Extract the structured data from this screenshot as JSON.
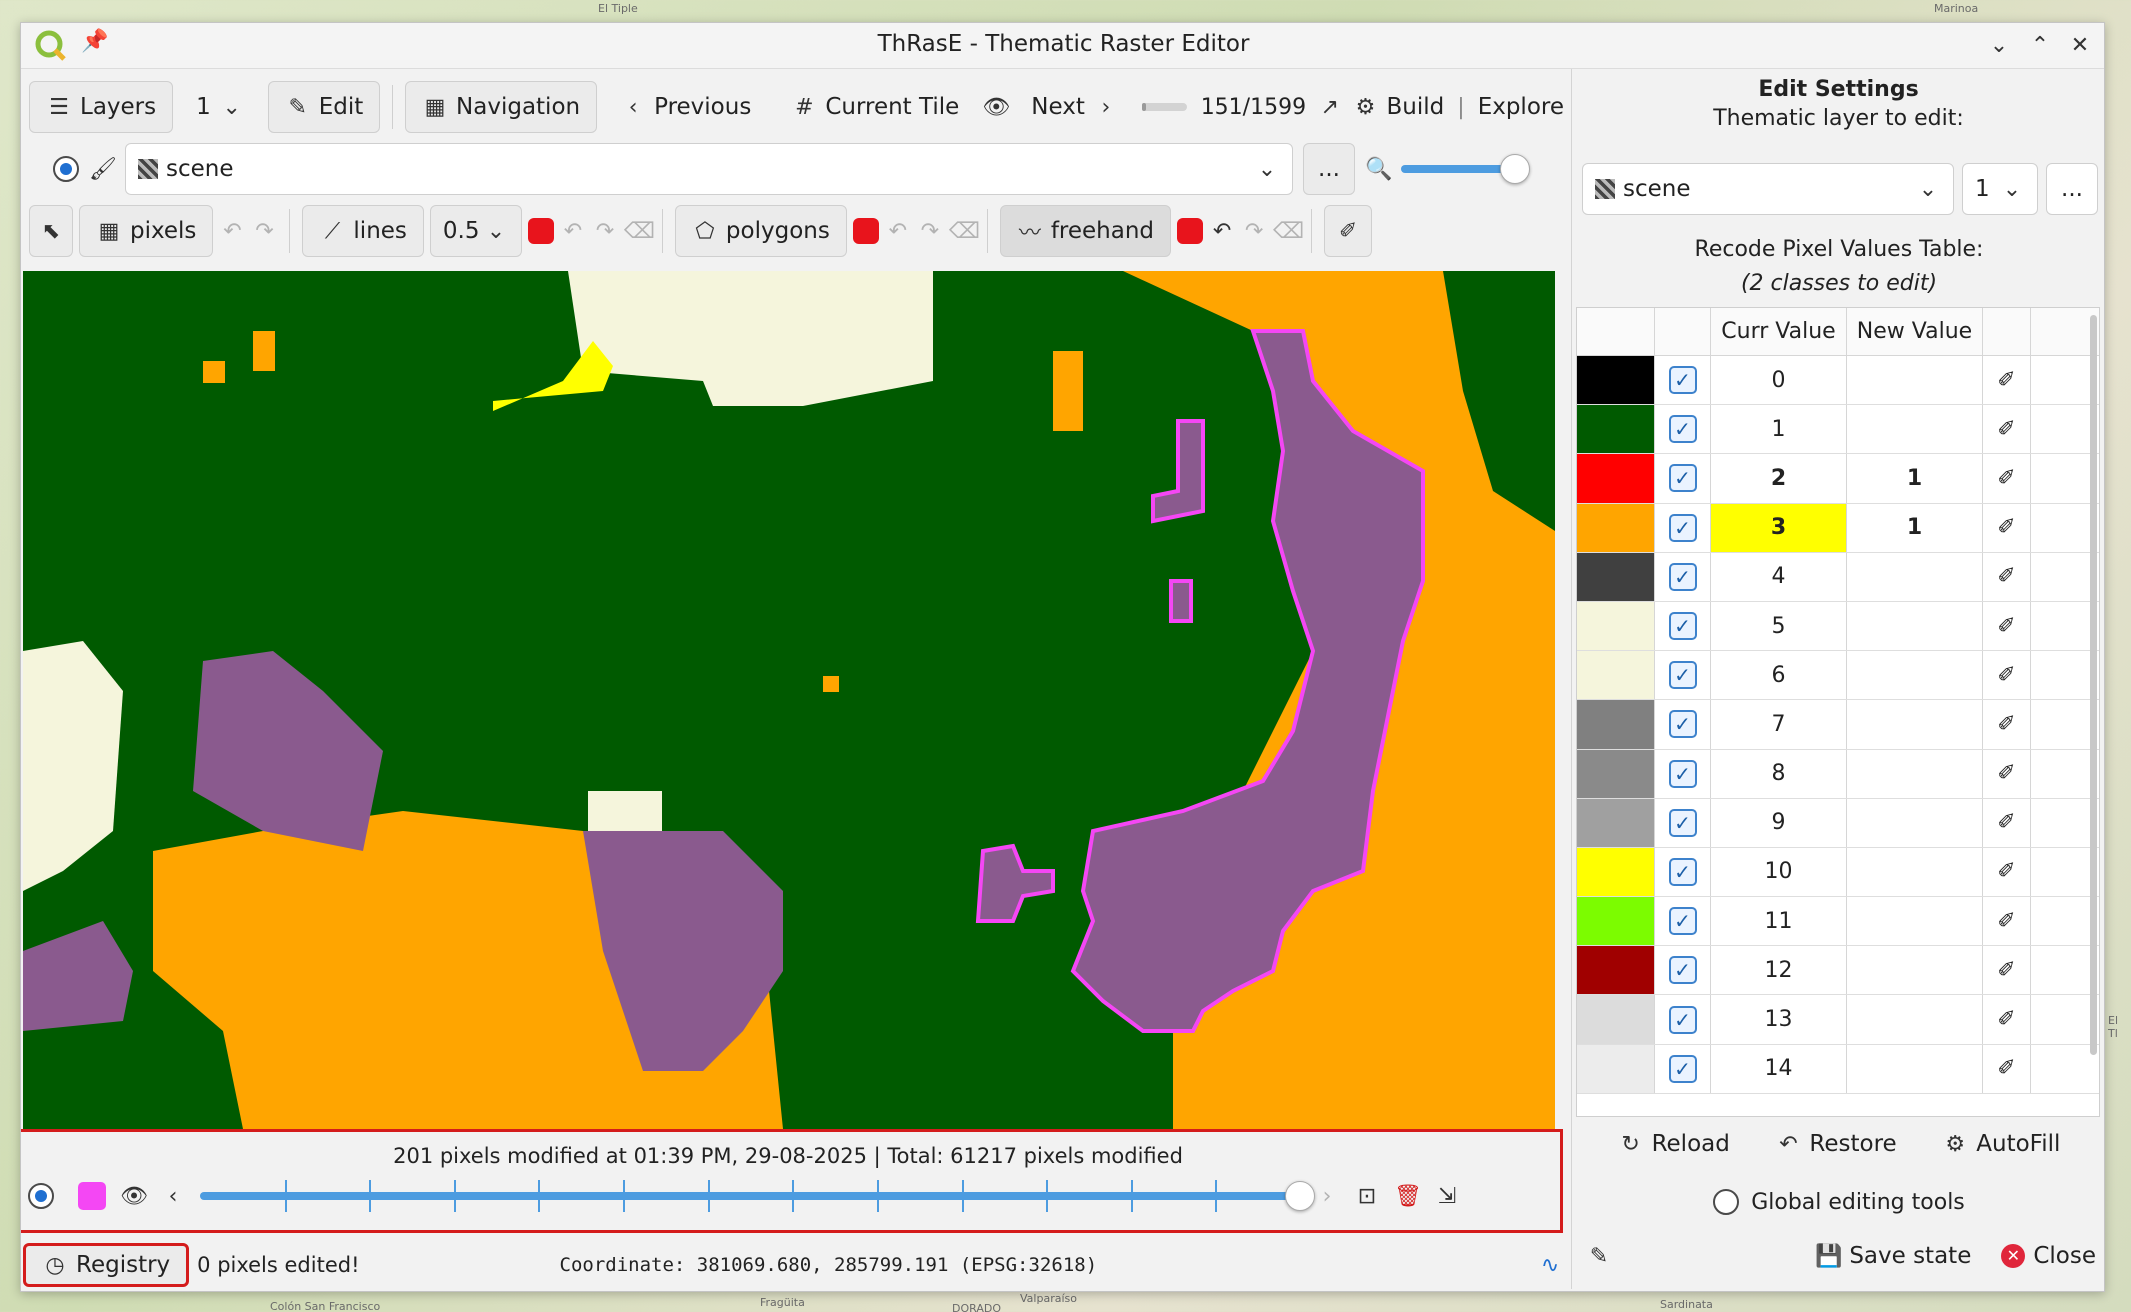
{
  "background_labels": [
    "El Tiple",
    "Marinoa",
    "Fragüita",
    "Valparaíso",
    "DORADO",
    "Colón San Francisco",
    "Sardinata",
    "El Tl"
  ],
  "window": {
    "title": "ThRasE - Thematic Raster Editor"
  },
  "toolbar": {
    "layers_label": "Layers",
    "layers_count": "1",
    "edit_label": "Edit",
    "navigation_label": "Navigation",
    "previous_label": "Previous",
    "current_tile_label": "Current Tile",
    "next_label": "Next",
    "tile_counter": "151/1599",
    "tile_progress": 0.094,
    "build_label": "Build",
    "explore_label": "Explore"
  },
  "layer_row": {
    "layer_name": "scene",
    "more_label": "...",
    "zoom_level": 0.95
  },
  "tools": {
    "pixels_label": "pixels",
    "lines_label": "lines",
    "line_width": "0.5",
    "polygons_label": "polygons",
    "freehand_label": "freehand",
    "tool_color": "#e8141c"
  },
  "history": {
    "message": "201 pixels modified at 01:39 PM, 29-08-2025 | Total: 61217 pixels modified",
    "position": 1.0,
    "highlight_color": "#f447f4"
  },
  "statusbar": {
    "registry_label": "Registry",
    "edited_message": "0 pixels edited!",
    "coordinate": "Coordinate:  381069.680, 285799.191 (EPSG:32618)"
  },
  "settings": {
    "title": "Edit Settings",
    "subtitle": "Thematic layer to edit:",
    "layer_name": "scene",
    "band": "1",
    "more_label": "...",
    "table_title": "Recode Pixel Values Table:",
    "table_subtitle": "(2 classes to edit)",
    "col_curr": "Curr Value",
    "col_new": "New Value",
    "rows": [
      {
        "color": "#000000",
        "value": "0",
        "new": ""
      },
      {
        "color": "#005a00",
        "value": "1",
        "new": ""
      },
      {
        "color": "#ff0000",
        "value": "2",
        "new": "1"
      },
      {
        "color": "#ffa500",
        "value": "3",
        "new": "1"
      },
      {
        "color": "#404040",
        "value": "4",
        "new": ""
      },
      {
        "color": "#f5f5dc",
        "value": "5",
        "new": ""
      },
      {
        "color": "#f5f5dc",
        "value": "6",
        "new": ""
      },
      {
        "color": "#808080",
        "value": "7",
        "new": ""
      },
      {
        "color": "#8a8a8a",
        "value": "8",
        "new": ""
      },
      {
        "color": "#a0a0a0",
        "value": "9",
        "new": ""
      },
      {
        "color": "#ffff00",
        "value": "10",
        "new": ""
      },
      {
        "color": "#7cfc00",
        "value": "11",
        "new": ""
      },
      {
        "color": "#a00000",
        "value": "12",
        "new": ""
      },
      {
        "color": "#dcdcdc",
        "value": "13",
        "new": ""
      },
      {
        "color": "#ececec",
        "value": "14",
        "new": ""
      }
    ],
    "reload_label": "Reload",
    "restore_label": "Restore",
    "autofill_label": "AutoFill",
    "global_tools_label": "Global editing tools",
    "save_state_label": "Save state",
    "close_label": "Close"
  },
  "raster_colors": {
    "forest": "#005a00",
    "orange": "#ffa500",
    "purple": "#8a5a8e",
    "cream": "#f5f5dc",
    "yellow": "#ffff00",
    "outline": "#f447f4"
  }
}
